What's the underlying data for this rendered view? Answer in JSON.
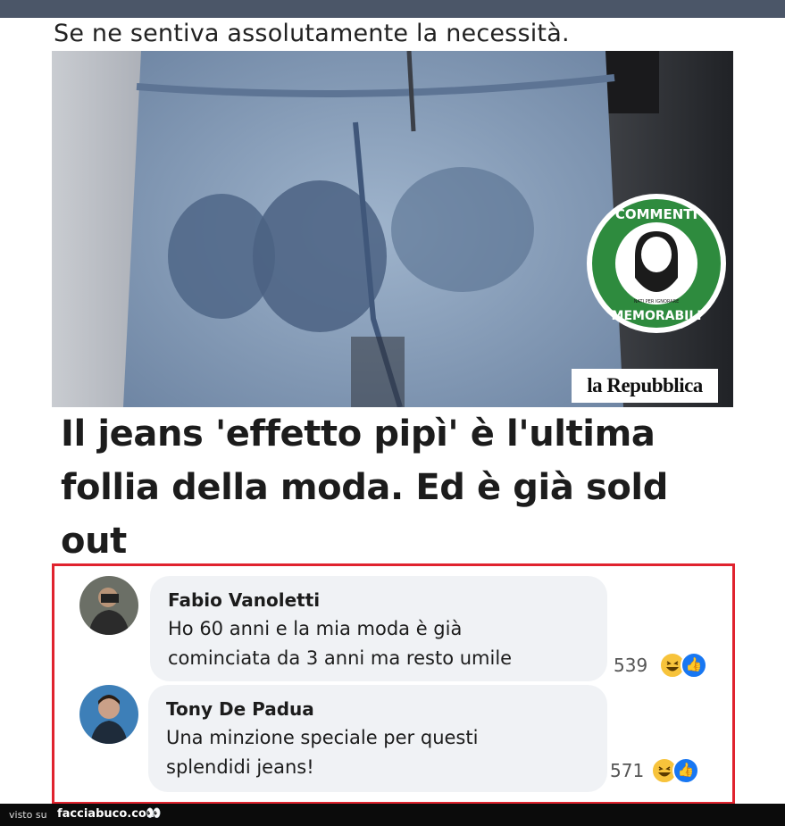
{
  "post": {
    "caption": "Se ne sentiva assolutamente la necessità.",
    "headline_lines": [
      "Il jeans 'effetto pipì' è l'ultima",
      "follia della moda. Ed è già sold",
      "out"
    ]
  },
  "image": {
    "badge_top": "COMMENTI",
    "badge_bottom": "MEMORABILI",
    "badge_inner": "NATI PER IGNORARE",
    "source": "la Repubblica"
  },
  "comments": [
    {
      "author": "Fabio Vanoletti",
      "text_lines": [
        "Ho 60 anni e la mia moda è già",
        "cominciata da 3 anni ma resto umile"
      ],
      "reaction_count": "539",
      "reactions": [
        "haha-icon",
        "like-icon"
      ]
    },
    {
      "author": "Tony De Padua",
      "text_lines": [
        "Una minzione speciale per questi",
        "splendidi jeans!"
      ],
      "reaction_count": "571",
      "reactions": [
        "haha-icon",
        "like-icon"
      ]
    }
  ],
  "footer": {
    "visto": "visto su",
    "site": "facciabuco.com",
    "logo_icon": "eyes-icon"
  },
  "colors": {
    "highlight_border": "#e0232e",
    "badge_green": "#2e8b3e",
    "like_blue": "#1877f2",
    "haha_yellow": "#f7c33b"
  }
}
